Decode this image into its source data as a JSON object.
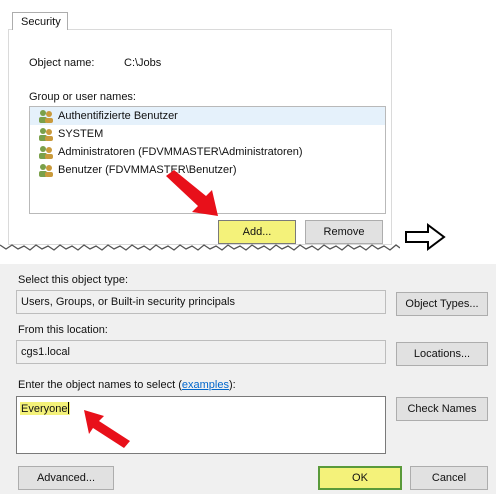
{
  "security_panel": {
    "tab_label": "Security",
    "object_name_label": "Object name:",
    "object_name_value": "C:\\Jobs",
    "group_label": "Group or user names:",
    "users": [
      {
        "name": "Authentifizierte Benutzer",
        "selected": true
      },
      {
        "name": "SYSTEM",
        "selected": false
      },
      {
        "name": "Administratoren (FDVMMASTER\\Administratoren)",
        "selected": false
      },
      {
        "name": "Benutzer (FDVMMASTER\\Benutzer)",
        "selected": false
      }
    ],
    "add_label": "Add...",
    "remove_label": "Remove"
  },
  "select_dialog": {
    "object_type_label": "Select this object type:",
    "object_type_value": "Users, Groups, or Built-in security principals",
    "object_types_button": "Object Types...",
    "location_label": "From this location:",
    "location_value": "cgs1.local",
    "locations_button": "Locations...",
    "enter_names_label_pre": "Enter the object names to select (",
    "examples_link": "examples",
    "enter_names_label_post": "):",
    "names_value": "Everyone",
    "check_names_button": "Check Names",
    "advanced_button": "Advanced...",
    "ok_button": "OK",
    "cancel_button": "Cancel"
  },
  "colors": {
    "highlight": "#f4f27a",
    "annotation_arrow": "#e8101a",
    "ok_border": "#5a9a3a"
  },
  "icons": [
    "users-icon",
    "annotation-arrow",
    "step-arrow-icon"
  ]
}
